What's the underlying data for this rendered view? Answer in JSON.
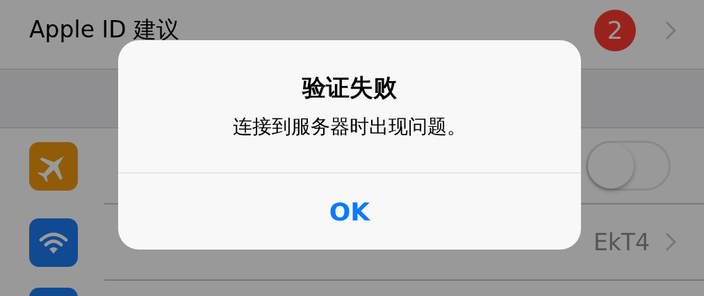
{
  "settings_rows": [
    {
      "kind": "account",
      "label": "Apple ID 建议",
      "badge": "2"
    },
    {
      "kind": "gap"
    },
    {
      "kind": "airplane",
      "on": false
    },
    {
      "kind": "wifi",
      "value": "EkT4"
    },
    {
      "kind": "cutoff"
    }
  ],
  "alert": {
    "title": "验证失败",
    "message": "连接到服务器时出现问题。",
    "buttons": [
      "OK"
    ]
  }
}
